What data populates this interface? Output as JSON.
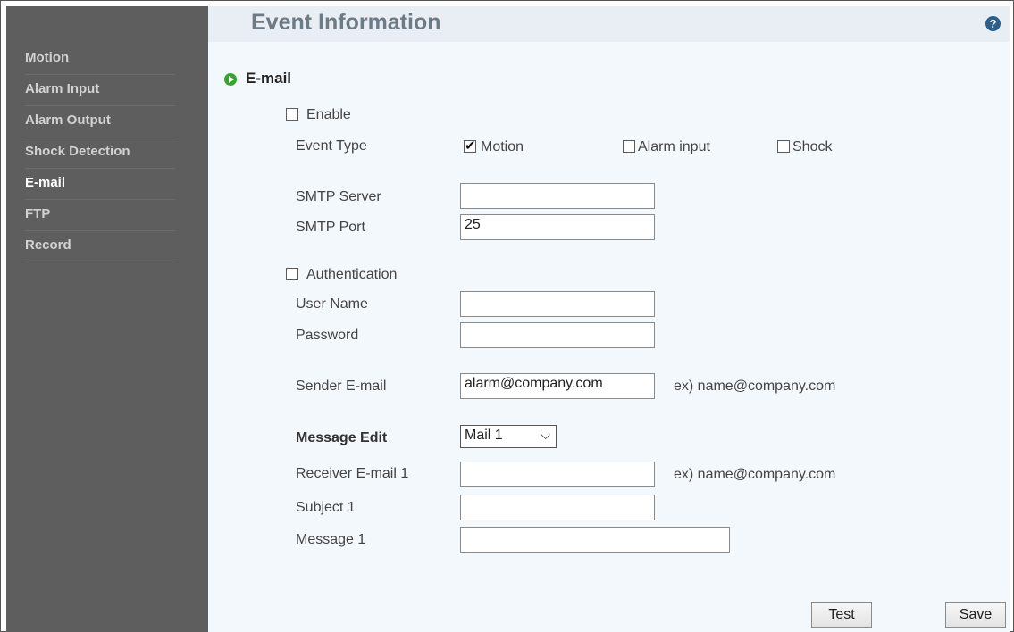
{
  "sidebar": {
    "items": [
      {
        "label": "Motion"
      },
      {
        "label": "Alarm Input"
      },
      {
        "label": "Alarm Output"
      },
      {
        "label": "Shock Detection"
      },
      {
        "label": "E-mail"
      },
      {
        "label": "FTP"
      },
      {
        "label": "Record"
      }
    ]
  },
  "header": {
    "title": "Event Information",
    "help_icon": "question-mark-icon",
    "help_glyph": "?"
  },
  "section": {
    "title": "E-mail",
    "icon": "green-arrow-icon"
  },
  "form": {
    "enable": {
      "label": "Enable",
      "checked": false
    },
    "event_type": {
      "label": "Event Type",
      "options": [
        {
          "label": "Motion",
          "checked": true
        },
        {
          "label": "Alarm input",
          "checked": false
        },
        {
          "label": "Shock",
          "checked": false
        }
      ]
    },
    "smtp_server": {
      "label": "SMTP Server",
      "value": ""
    },
    "smtp_port": {
      "label": "SMTP Port",
      "value": "25"
    },
    "authentication": {
      "label": "Authentication",
      "checked": false
    },
    "user_name": {
      "label": "User Name",
      "value": ""
    },
    "password": {
      "label": "Password",
      "value": ""
    },
    "sender_email": {
      "label": "Sender E-mail",
      "value": "alarm@company.com",
      "hint": "ex) name@company.com"
    },
    "message_edit": {
      "label": "Message Edit",
      "selected": "Mail 1"
    },
    "receiver_email": {
      "label": "Receiver E-mail 1",
      "value": "",
      "hint": "ex) name@company.com"
    },
    "subject": {
      "label": "Subject 1",
      "value": ""
    },
    "message": {
      "label": "Message 1",
      "value": ""
    }
  },
  "buttons": {
    "test": "Test",
    "save": "Save"
  }
}
